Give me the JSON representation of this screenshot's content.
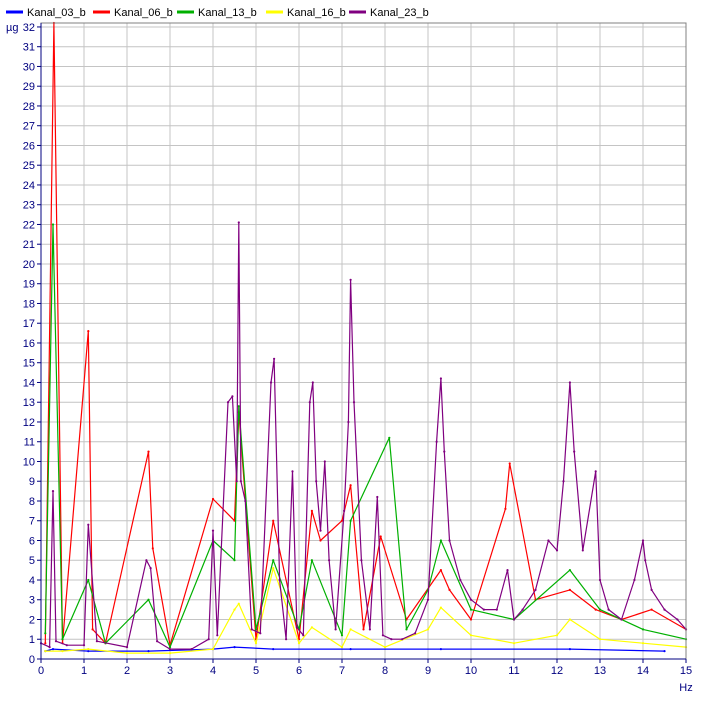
{
  "chart_data": {
    "type": "line",
    "title": "",
    "xlabel": "",
    "ylabel": "",
    "x_unit": "Hz",
    "y_unit": "µg",
    "xlim": [
      0,
      15
    ],
    "ylim": [
      0,
      32.2
    ],
    "x_ticks": [
      "0",
      "1",
      "2",
      "3",
      "4",
      "5",
      "6",
      "7",
      "8",
      "9",
      "10",
      "11",
      "12",
      "13",
      "14",
      "15"
    ],
    "y_ticks": [
      "0",
      "1",
      "2",
      "3",
      "4",
      "5",
      "6",
      "7",
      "8",
      "9",
      "10",
      "11",
      "12",
      "13",
      "14",
      "15",
      "16",
      "17",
      "18",
      "19",
      "20",
      "21",
      "22",
      "23",
      "24",
      "25",
      "26",
      "27",
      "28",
      "29",
      "30",
      "31",
      "32"
    ],
    "grid": true,
    "legend_position": "top-left",
    "series": [
      {
        "name": "Kanal_03_b",
        "color": "#0000ff",
        "x": [
          0.1,
          0.28,
          1.1,
          2.5,
          4.0,
          4.5,
          5.4,
          7.2,
          9.3,
          12.3,
          14.5
        ],
        "values": [
          0.4,
          0.5,
          0.4,
          0.4,
          0.5,
          0.6,
          0.5,
          0.5,
          0.5,
          0.5,
          0.4
        ]
      },
      {
        "name": "Kanal_06_b",
        "color": "#ff0000",
        "x": [
          0.1,
          0.3,
          0.5,
          1.1,
          1.2,
          1.5,
          2.5,
          2.6,
          3.0,
          4.0,
          4.5,
          4.6,
          5.0,
          5.4,
          6.0,
          6.3,
          6.5,
          7.0,
          7.2,
          7.5,
          7.9,
          8.5,
          9.3,
          9.5,
          10.0,
          10.8,
          10.9,
          11.5,
          12.3,
          12.9,
          13.5,
          14.2,
          15.0
        ],
        "values": [
          0.8,
          32.2,
          0.8,
          16.6,
          1.5,
          0.8,
          10.5,
          5.6,
          0.7,
          8.1,
          7.0,
          12.5,
          1.0,
          7.0,
          1.0,
          7.5,
          6.0,
          7.0,
          8.8,
          1.5,
          6.2,
          2.0,
          4.5,
          3.5,
          2.0,
          7.6,
          9.9,
          3.0,
          3.5,
          2.5,
          2.0,
          2.5,
          1.5
        ]
      },
      {
        "name": "Kanal_13_b",
        "color": "#00b000",
        "x": [
          0.1,
          0.28,
          0.5,
          1.1,
          1.5,
          2.5,
          3.0,
          4.0,
          4.5,
          4.6,
          5.0,
          5.4,
          6.0,
          6.3,
          7.0,
          7.2,
          8.1,
          8.5,
          9.0,
          9.3,
          10.0,
          11.0,
          12.3,
          13.0,
          14.0,
          15.0
        ],
        "values": [
          1.3,
          22.0,
          1.0,
          4.0,
          0.8,
          3.0,
          0.6,
          6.0,
          5.0,
          12.8,
          1.5,
          5.0,
          1.5,
          5.0,
          1.2,
          7.0,
          11.2,
          1.5,
          3.5,
          6.0,
          2.5,
          2.0,
          4.5,
          2.5,
          1.5,
          1.0
        ]
      },
      {
        "name": "Kanal_16_b",
        "color": "#ffff00",
        "x": [
          0.1,
          0.5,
          1.1,
          2.0,
          3.0,
          4.0,
          4.5,
          4.6,
          5.0,
          5.4,
          6.0,
          6.3,
          7.0,
          7.2,
          8.0,
          9.0,
          9.3,
          10.0,
          11.0,
          12.0,
          12.3,
          13.0,
          14.0,
          15.0
        ],
        "values": [
          0.4,
          0.4,
          0.5,
          0.3,
          0.3,
          0.5,
          2.5,
          2.8,
          0.8,
          4.6,
          0.8,
          1.6,
          0.6,
          1.5,
          0.6,
          1.5,
          2.6,
          1.2,
          0.8,
          1.2,
          2.0,
          1.0,
          0.8,
          0.6
        ]
      },
      {
        "name": "Kanal_23_b",
        "color": "#800080",
        "x": [
          0.0,
          0.2,
          0.28,
          0.35,
          0.6,
          1.0,
          1.1,
          1.3,
          2.0,
          2.45,
          2.55,
          2.7,
          3.0,
          3.5,
          3.9,
          4.0,
          4.1,
          4.35,
          4.45,
          4.55,
          4.6,
          4.65,
          4.75,
          4.9,
          5.1,
          5.35,
          5.42,
          5.55,
          5.7,
          5.85,
          5.95,
          6.1,
          6.25,
          6.32,
          6.4,
          6.5,
          6.6,
          6.7,
          6.85,
          7.05,
          7.15,
          7.2,
          7.28,
          7.45,
          7.65,
          7.82,
          7.95,
          8.15,
          8.4,
          8.7,
          9.0,
          9.2,
          9.3,
          9.38,
          9.5,
          9.75,
          10.0,
          10.3,
          10.6,
          10.85,
          11.0,
          11.2,
          11.5,
          11.8,
          12.0,
          12.15,
          12.3,
          12.4,
          12.6,
          12.9,
          13.0,
          13.2,
          13.5,
          13.8,
          14.0,
          14.05,
          14.2,
          14.5,
          14.8,
          15.0
        ],
        "values": [
          0.8,
          0.6,
          8.5,
          0.9,
          0.7,
          0.7,
          6.8,
          0.9,
          0.6,
          5.0,
          4.6,
          0.9,
          0.5,
          0.5,
          1.0,
          6.5,
          1.2,
          13.0,
          13.3,
          9.0,
          22.1,
          9.0,
          8.0,
          1.5,
          1.3,
          14.0,
          15.2,
          4.0,
          1.0,
          9.5,
          1.6,
          1.2,
          13.0,
          14.0,
          9.0,
          6.5,
          10.0,
          5.0,
          1.5,
          7.5,
          12.0,
          19.2,
          13.0,
          5.0,
          1.5,
          8.2,
          1.2,
          1.0,
          1.0,
          1.3,
          3.0,
          11.0,
          14.2,
          10.5,
          6.0,
          4.0,
          3.0,
          2.5,
          2.5,
          4.5,
          2.0,
          2.5,
          3.5,
          6.0,
          5.5,
          9.0,
          14.0,
          10.5,
          5.5,
          9.5,
          4.0,
          2.5,
          2.0,
          4.0,
          6.0,
          5.0,
          3.5,
          2.5,
          2.0,
          1.5
        ]
      }
    ]
  }
}
